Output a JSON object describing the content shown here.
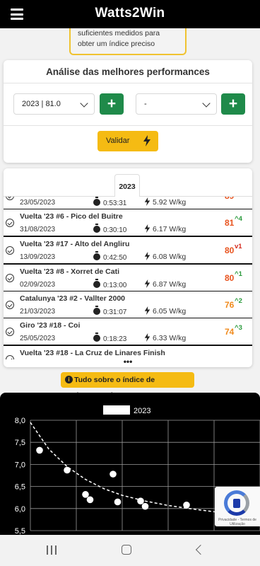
{
  "app": {
    "title": "Watts2Win",
    "menu_icon": "hamburger-menu-icon"
  },
  "notice": {
    "text": "suficientes medidos para obter um índice preciso"
  },
  "analysis": {
    "title": "Análise das melhores performances",
    "select_season": {
      "value": "2023 | 81.0"
    },
    "select_compare": {
      "value": "-"
    },
    "add_button": "+",
    "validate_label": "Validar"
  },
  "tabs": [
    {
      "label": "2023"
    }
  ],
  "performances": [
    {
      "name": "",
      "date": "23/05/2023",
      "time": "0:53:31",
      "power": "5.92 W/kg",
      "score": "89",
      "delta": "",
      "delta_dir": "",
      "score_color": "#e8531e"
    },
    {
      "name": "Vuelta '23 #6 - Pico del Buitre",
      "date": "31/08/2023",
      "time": "0:30:10",
      "power": "6.17 W/kg",
      "score": "81",
      "delta": "4",
      "delta_dir": "up",
      "score_color": "#e8531e"
    },
    {
      "name": "Vuelta '23 #17 - Alto del Angliru",
      "date": "13/09/2023",
      "time": "0:42:50",
      "power": "6.08 W/kg",
      "score": "80",
      "delta": "1",
      "delta_dir": "down",
      "score_color": "#e8531e"
    },
    {
      "name": "Vuelta '23 #8 - Xorret de Cati",
      "date": "02/09/2023",
      "time": "0:13:00",
      "power": "6.87 W/kg",
      "score": "80",
      "delta": "1",
      "delta_dir": "up",
      "score_color": "#e8531e"
    },
    {
      "name": "Catalunya '23 #2 - Vallter 2000",
      "date": "21/03/2023",
      "time": "0:31:07",
      "power": "6.05 W/kg",
      "score": "76",
      "delta": "2",
      "delta_dir": "up",
      "score_color": "#f08a1c"
    },
    {
      "name": "Giro '23 #18 - Coi",
      "date": "25/05/2023",
      "time": "0:18:23",
      "power": "6.33 W/kg",
      "score": "74",
      "delta": "3",
      "delta_dir": "up",
      "score_color": "#f08a1c"
    },
    {
      "name": "Vuelta '23 #18 - La Cruz de Linares Finish",
      "date": "",
      "time": "",
      "power": "",
      "score": "",
      "delta": "",
      "delta_dir": "",
      "score_color": "#f08a1c"
    }
  ],
  "more_indicator": "•••",
  "info_badge": {
    "icon": "info-icon",
    "label": "Tudo sobre o índice de desempenho"
  },
  "chart_data": {
    "type": "scatter",
    "legend": [
      "2023"
    ],
    "legend_position": "top",
    "ylim": [
      5.5,
      8.0
    ],
    "y_ticks": [
      "8,0",
      "7,5",
      "7,0",
      "6,5",
      "6,0",
      "5,5"
    ],
    "x_range": [
      0,
      50
    ],
    "grid": true,
    "points": [
      {
        "x": 2,
        "y": 7.32
      },
      {
        "x": 8,
        "y": 6.87
      },
      {
        "x": 12,
        "y": 6.32
      },
      {
        "x": 13,
        "y": 6.2
      },
      {
        "x": 18,
        "y": 6.78
      },
      {
        "x": 19,
        "y": 6.15
      },
      {
        "x": 24,
        "y": 6.17
      },
      {
        "x": 25,
        "y": 6.05
      },
      {
        "x": 34,
        "y": 6.08
      },
      {
        "x": 44,
        "y": 5.92
      }
    ],
    "trend": [
      {
        "x": 0,
        "y": 7.95
      },
      {
        "x": 4,
        "y": 7.35
      },
      {
        "x": 8,
        "y": 6.95
      },
      {
        "x": 12,
        "y": 6.66
      },
      {
        "x": 16,
        "y": 6.45
      },
      {
        "x": 20,
        "y": 6.3
      },
      {
        "x": 25,
        "y": 6.17
      },
      {
        "x": 30,
        "y": 6.07
      },
      {
        "x": 36,
        "y": 5.98
      },
      {
        "x": 42,
        "y": 5.9
      },
      {
        "x": 50,
        "y": 5.82
      }
    ],
    "colors": {
      "background": "#000000",
      "points": "#ffffff",
      "grid": "#9a9a9a",
      "text": "#ffffff"
    }
  },
  "recaptcha": {
    "terms": "Privacidade - Termos de Utilização"
  },
  "system_nav": [
    "recent-apps-icon",
    "home-icon",
    "back-icon"
  ],
  "colors": {
    "accent": "#f5bb13",
    "green": "#1f8a4a",
    "up": "#2a9a3c",
    "down": "#d42a1e"
  }
}
